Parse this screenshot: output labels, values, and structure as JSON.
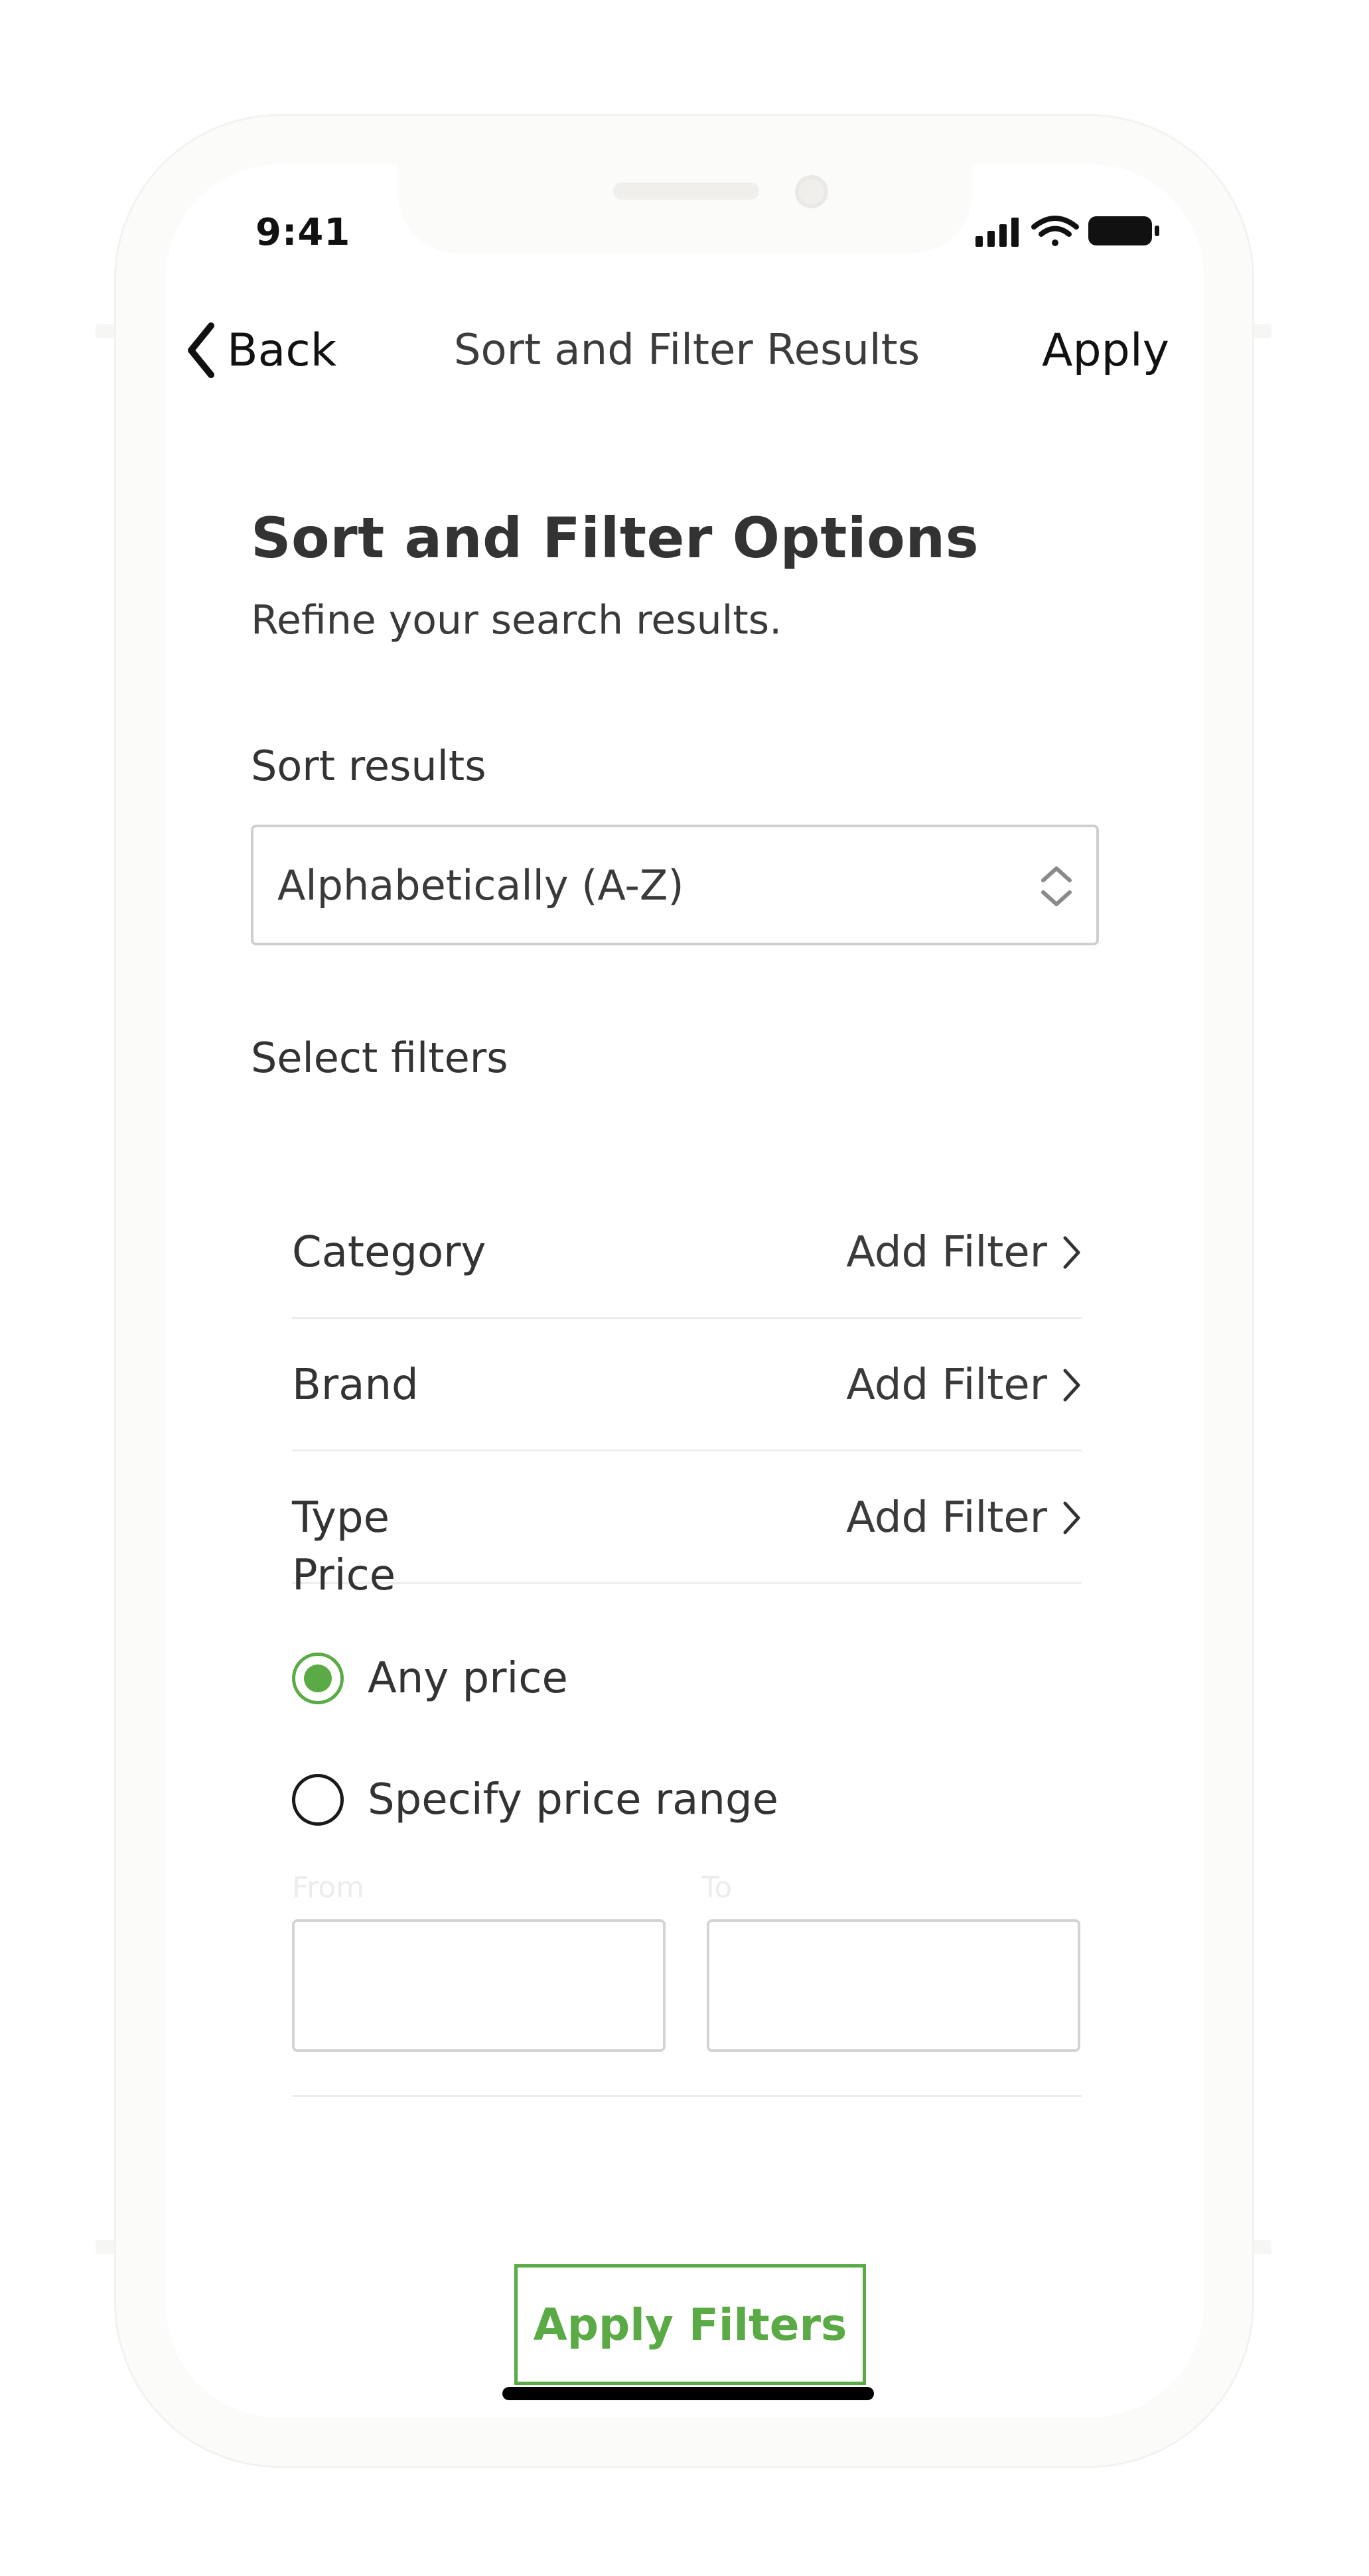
{
  "status_bar": {
    "time": "9:41",
    "icons": [
      "signal-icon",
      "wifi-icon",
      "battery-icon"
    ]
  },
  "nav": {
    "back_label": "Back",
    "title": "Sort and Filter Results",
    "apply_label": "Apply"
  },
  "content": {
    "title": "Sort and Filter Options",
    "subtitle": "Refine your search results.",
    "sort": {
      "label": "Sort results",
      "selected": "Alphabetically (A-Z)"
    },
    "filters": {
      "label": "Select filters",
      "rows": [
        {
          "name": "Category",
          "action": "Add Filter"
        },
        {
          "name": "Brand",
          "action": "Add Filter"
        },
        {
          "name": "Type",
          "action": "Add Filter"
        }
      ]
    },
    "price": {
      "label": "Price",
      "options": [
        {
          "label": "Any price",
          "selected": true
        },
        {
          "label": "Specify price range",
          "selected": false
        }
      ],
      "from_label": "From",
      "to_label": "To",
      "from_value": "",
      "to_value": ""
    },
    "apply_button": "Apply Filters"
  },
  "colors": {
    "accent": "#5aaa45",
    "text": "#333333",
    "border": "#cfcfcf"
  }
}
